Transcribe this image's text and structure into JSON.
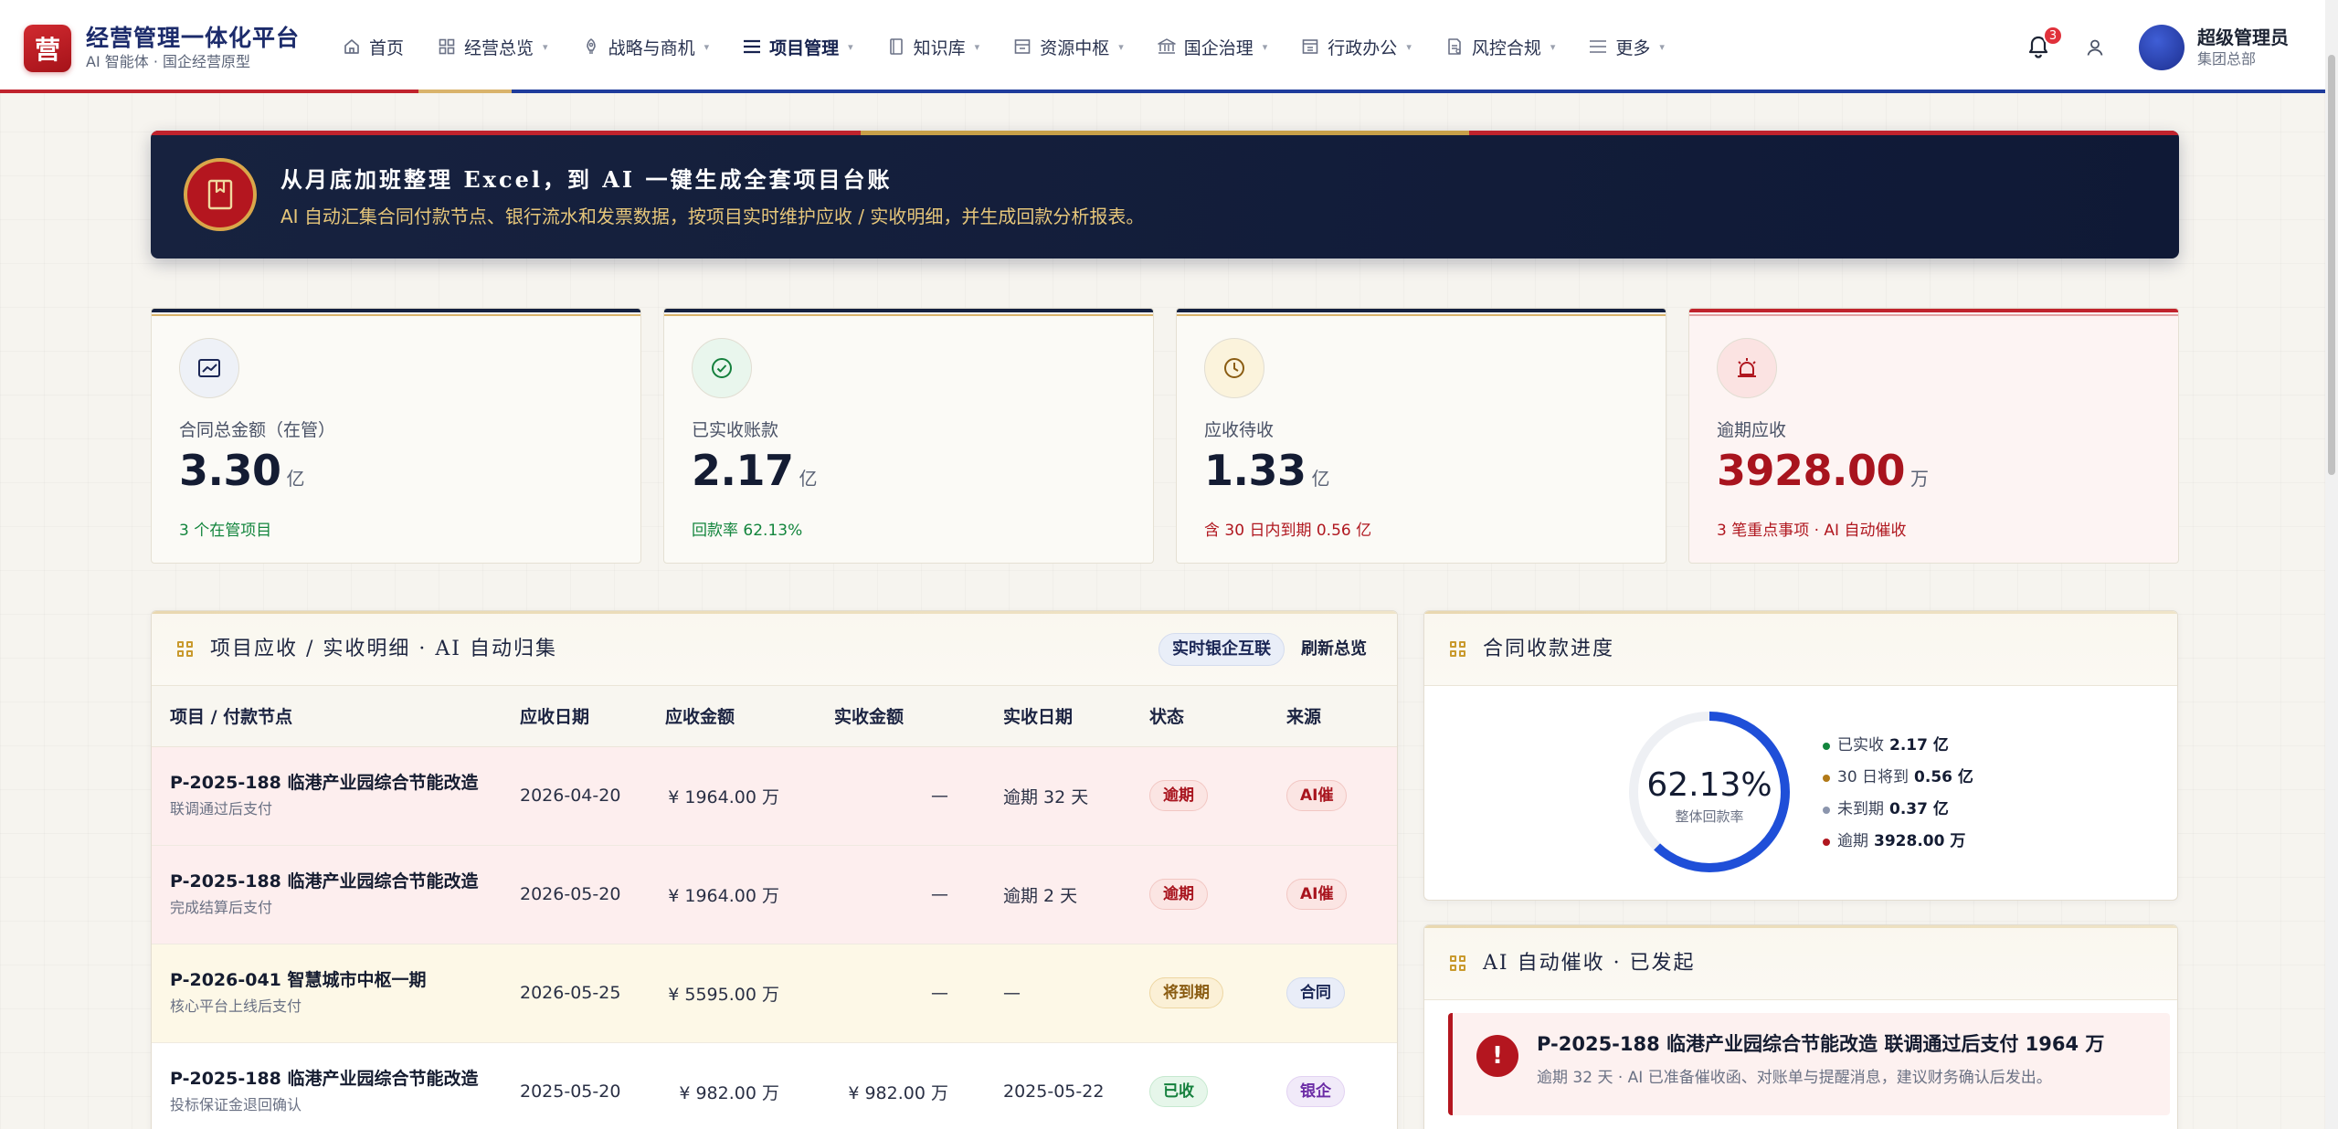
{
  "brand": {
    "logo": "营",
    "title": "经营管理一体化平台",
    "subtitle": "AI 智能体 · 国企经营原型"
  },
  "nav": [
    {
      "label": "首页",
      "icon": "home-icon",
      "caret": false,
      "active": false
    },
    {
      "label": "经营总览",
      "icon": "grid-icon",
      "caret": true,
      "active": false
    },
    {
      "label": "战略与商机",
      "icon": "rocket-icon",
      "caret": true,
      "active": false
    },
    {
      "label": "项目管理",
      "icon": "list-icon",
      "caret": true,
      "active": true
    },
    {
      "label": "知识库",
      "icon": "book-icon",
      "caret": true,
      "active": false
    },
    {
      "label": "资源中枢",
      "icon": "store-icon",
      "caret": true,
      "active": false
    },
    {
      "label": "国企治理",
      "icon": "bank-icon",
      "caret": true,
      "active": false
    },
    {
      "label": "行政办公",
      "icon": "office-icon",
      "caret": true,
      "active": false
    },
    {
      "label": "风控合规",
      "icon": "shield-doc-icon",
      "caret": true,
      "active": false
    },
    {
      "label": "更多",
      "icon": "menu-icon",
      "caret": true,
      "active": false
    }
  ],
  "user": {
    "notifications": "3",
    "name": "超级管理员",
    "org": "集团总部"
  },
  "banner": {
    "title": "从月底加班整理 Excel，到 AI 一键生成全套项目台账",
    "subtitle": "AI 自动汇集合同付款节点、银行流水和发票数据，按项目实时维护应收 / 实收明细，并生成回款分析报表。"
  },
  "stats": [
    {
      "label": "合同总金额（在管）",
      "value": "3.30",
      "unit": "亿",
      "note": "3 个在管项目",
      "note_color": "#13853d",
      "icon": "chart-icon",
      "icon_bg": "#eef1f7",
      "icon_color": "#1b2756"
    },
    {
      "label": "已实收账款",
      "value": "2.17",
      "unit": "亿",
      "note": "回款率 62.13%",
      "note_color": "#13853d",
      "icon": "check-circle-icon",
      "icon_bg": "#e9f6ed",
      "icon_color": "#15803d"
    },
    {
      "label": "应收待收",
      "value": "1.33",
      "unit": "亿",
      "note": "含 30 日内到期 0.56 亿",
      "note_color": "#b0171f",
      "icon": "clock-icon",
      "icon_bg": "#fbf3dc",
      "icon_color": "#8a5c12"
    },
    {
      "label": "逾期应收",
      "value": "3928.00",
      "unit": "万",
      "note": "3 笔重点事项 · AI 自动催收",
      "note_color": "#b0171f",
      "icon": "siren-icon",
      "icon_bg": "#fbe3e2",
      "icon_color": "#b0171f"
    }
  ],
  "receivables": {
    "title": "项目应收 / 实收明细 · AI 自动归集",
    "btn_bank": "实时银企互联",
    "btn_refresh": "刷新总览",
    "columns": [
      "项目 / 付款节点",
      "应收日期",
      "应收金额",
      "实收金额",
      "实收日期",
      "状态",
      "来源"
    ],
    "rows": [
      {
        "project": "P-2025-188 临港产业园综合节能改造",
        "node": "联调通过后支付",
        "due_date": "2026-04-20",
        "due_amount": "¥ 1964.00 万",
        "paid_amount": "—",
        "paid_date": "逾期 32 天",
        "status": "逾期",
        "source": "AI催",
        "row_class": "overdue",
        "status_class": "overdue",
        "source_class": "src-ai",
        "paid_date_class": "red-text"
      },
      {
        "project": "P-2025-188 临港产业园综合节能改造",
        "node": "完成结算后支付",
        "due_date": "2026-05-20",
        "due_amount": "¥ 1964.00 万",
        "paid_amount": "—",
        "paid_date": "逾期 2 天",
        "status": "逾期",
        "source": "AI催",
        "row_class": "overdue",
        "status_class": "overdue",
        "source_class": "src-ai",
        "paid_date_class": "red-text"
      },
      {
        "project": "P-2026-041 智慧城市中枢一期",
        "node": "核心平台上线后支付",
        "due_date": "2026-05-25",
        "due_amount": "¥ 5595.00 万",
        "paid_amount": "—",
        "paid_date": "—",
        "status": "将到期",
        "source": "合同",
        "row_class": "soon",
        "status_class": "soon",
        "source_class": "src-contract",
        "paid_date_class": ""
      },
      {
        "project": "P-2025-188 临港产业园综合节能改造",
        "node": "投标保证金退回确认",
        "due_date": "2025-05-20",
        "due_amount": "¥ 982.00 万",
        "paid_amount": "¥ 982.00 万",
        "paid_date": "2025-05-22",
        "status": "已收",
        "source": "银企",
        "row_class": "done",
        "status_class": "done",
        "source_class": "src-bank",
        "paid_date_class": ""
      }
    ]
  },
  "progress": {
    "title": "合同收款进度",
    "percent": "62.13%",
    "percent_value": 62.13,
    "caption": "整体回款率",
    "ring_color": "#1f4fd8",
    "legend": [
      {
        "label": "已实收",
        "value": "2.17 亿",
        "color": "#13853d"
      },
      {
        "label": "30 日将到",
        "value": "0.56 亿",
        "color": "#b27a18"
      },
      {
        "label": "未到期",
        "value": "0.37 亿",
        "color": "#8b95ad"
      },
      {
        "label": "逾期",
        "value": "3928.00 万",
        "color": "#b0171f"
      }
    ]
  },
  "collection": {
    "title": "AI 自动催收 · 已发起",
    "alert_icon": "!",
    "alert_title": "P-2025-188 临港产业园综合节能改造 联调通过后支付 1964 万",
    "alert_desc": "逾期 32 天 · AI 已准备催收函、对账单与提醒消息，建议财务确认后发出。"
  }
}
